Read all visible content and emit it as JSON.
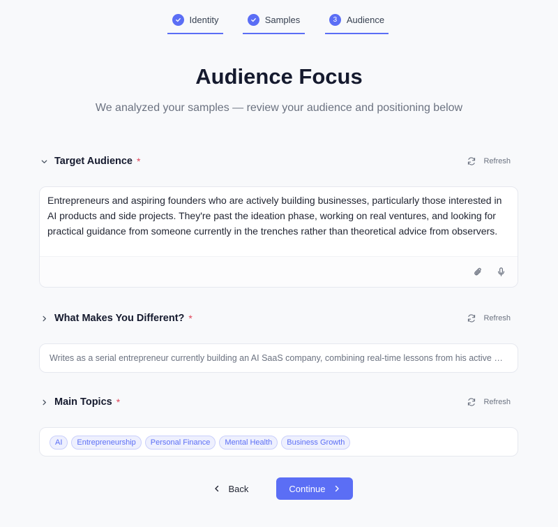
{
  "stepper": {
    "steps": [
      {
        "label": "Identity",
        "marker": "check-icon"
      },
      {
        "label": "Samples",
        "marker": "check-icon"
      },
      {
        "label": "Audience",
        "marker": "3"
      }
    ],
    "accent": "#5b6ef5"
  },
  "page": {
    "title": "Audience Focus",
    "subtitle": "We analyzed your samples — review your audience and positioning below"
  },
  "sections": {
    "target_audience": {
      "title": "Target Audience",
      "required_mark": "*",
      "refresh_label": "Refresh",
      "text": "Entrepreneurs and aspiring founders who are actively building businesses, particularly those interested in AI products and side projects. They're past the ideation phase, working on real ventures, and looking for practical guidance from someone currently in the trenches rather than theoretical advice from observers."
    },
    "difference": {
      "title": "What Makes You Different?",
      "required_mark": "*",
      "refresh_label": "Refresh",
      "text": "Writes as a serial entrepreneur currently building an AI SaaS company, combining real-time lessons from his active …"
    },
    "topics": {
      "title": "Main Topics",
      "required_mark": "*",
      "refresh_label": "Refresh",
      "tags": [
        "AI",
        "Entrepreneurship",
        "Personal Finance",
        "Mental Health",
        "Business Growth"
      ]
    }
  },
  "actions": {
    "back_label": "Back",
    "continue_label": "Continue"
  },
  "colors": {
    "accent": "#5b6ef5",
    "required": "#e0455a",
    "background": "#f8f9fb"
  }
}
